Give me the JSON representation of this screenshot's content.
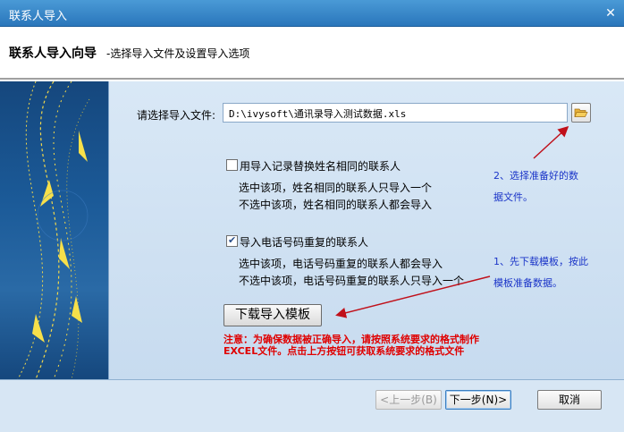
{
  "window": {
    "title": "联系人导入"
  },
  "header": {
    "main_title": "联系人导入向导",
    "subtitle": "-选择导入文件及设置导入选项"
  },
  "file": {
    "label": "请选择导入文件:",
    "value": "D:\\ivysoft\\通讯录导入测试数据.xls",
    "browse_icon": "folder-open-icon"
  },
  "options": {
    "replace_same_name": {
      "label": "用导入记录替换姓名相同的联系人",
      "checked": false,
      "desc_checked": "选中该项，姓名相同的联系人只导入一个",
      "desc_unchecked": "不选中该项，姓名相同的联系人都会导入"
    },
    "import_duplicate_phone": {
      "label": "导入电话号码重复的联系人",
      "checked": true,
      "desc_checked": "选中该项，电话号码重复的联系人都会导入",
      "desc_unchecked": "不选中该项，电话号码重复的联系人只导入一个"
    }
  },
  "download_template": {
    "label": "下载导入模板"
  },
  "notice": {
    "line1": "注意：为确保数据被正确导入，请按照系统要求的格式制作",
    "line2": "EXCEL文件。点击上方按钮可获取系统要求的格式文件",
    "color": "#e00000"
  },
  "annotations": {
    "step2_line1": "2、选择准备好的数",
    "step2_line2": "据文件。",
    "step1_line1": "1、先下载模板，按此",
    "step1_line2": "模板准备数据。",
    "color": "#1a34c8",
    "arrow_color": "#c0101a"
  },
  "footer": {
    "prev_label": "<上一步(B)",
    "next_label": "下一步(N)>",
    "cancel_label": "取消"
  },
  "colors": {
    "title_bar": "#2a76bb",
    "panel_bg": "#d9e8f6"
  }
}
